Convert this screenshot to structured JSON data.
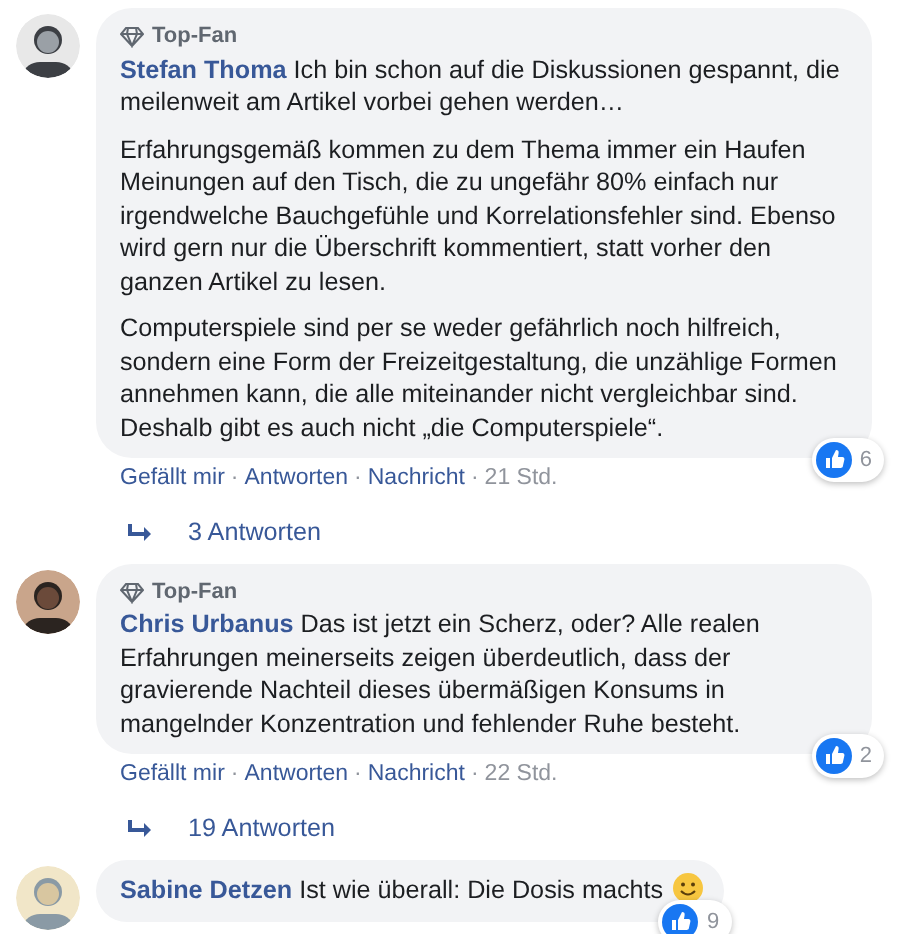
{
  "comments": [
    {
      "badge": "Top-Fan",
      "author": "Stefan Thoma",
      "paragraphs": [
        "Ich bin schon auf die Diskussionen gespannt, die meilenweit am Artikel vorbei gehen werden…",
        "Erfahrungsgemäß kommen zu dem Thema immer ein Haufen Meinungen auf den Tisch, die zu ungefähr 80% einfach nur irgendwelche Bauchgefühle und Korrelationsfehler sind. Ebenso wird gern nur die Überschrift kommentiert, statt vorher den ganzen Artikel zu lesen.",
        "Computerspiele sind per se weder gefährlich noch hilfreich, sondern eine Form der Freizeitgestaltung, die unzählige Formen annehmen kann, die alle miteinander nicht vergleichbar sind. Deshalb gibt es auch nicht „die Computerspiele“."
      ],
      "emoji": false,
      "likes": "6",
      "actions": [
        "Gefällt mir",
        "Antworten",
        "Nachricht"
      ],
      "separator": "·",
      "time": "21 Std.",
      "replies": "3 Antworten"
    },
    {
      "badge": "Top-Fan",
      "author": "Chris Urbanus",
      "paragraphs": [
        "Das ist jetzt ein Scherz, oder? Alle realen Erfahrungen meinerseits zeigen überdeutlich, dass der gravierende Nachteil dieses übermäßigen Konsums in mangelnder Konzentration und fehlender Ruhe besteht."
      ],
      "emoji": false,
      "likes": "2",
      "actions": [
        "Gefällt mir",
        "Antworten",
        "Nachricht"
      ],
      "separator": "·",
      "time": "22 Std.",
      "replies": "19 Antworten"
    },
    {
      "author": "Sabine Detzen",
      "paragraphs": [
        "Ist wie überall: Die Dosis machts"
      ],
      "emoji": true,
      "likes": "9"
    }
  ]
}
